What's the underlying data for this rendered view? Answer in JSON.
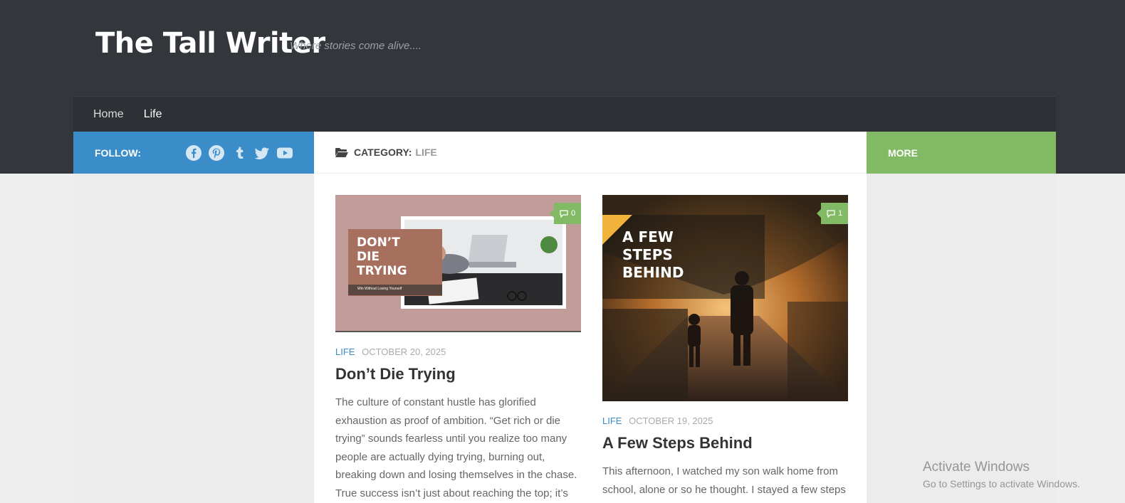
{
  "site": {
    "title": "The Tall Writer",
    "tagline": "Where stories come alive....",
    "nav": [
      {
        "label": "Home"
      },
      {
        "label": "Life"
      }
    ]
  },
  "sidebar_left": {
    "follow_label": "FOLLOW:",
    "social_icons": [
      "facebook-icon",
      "pinterest-icon",
      "tumblr-icon",
      "twitter-icon",
      "youtube-icon"
    ],
    "accent_color": "#3b8dca"
  },
  "sidebar_right": {
    "heading": "MORE",
    "accent_color": "#82b965"
  },
  "category_header": {
    "prefix": "CATEGORY:",
    "name": "LIFE"
  },
  "posts": [
    {
      "category": "LIFE",
      "date": "OCTOBER 20, 2025",
      "title": "Don’t Die Trying",
      "comments": "0",
      "image_text": {
        "headline_lines": [
          "DON’T",
          "DIE",
          "TRYING"
        ],
        "subline": "Win Without Losing Yourself"
      },
      "excerpt": "The culture of constant hustle has glorified exhaustion as proof of ambition. “Get rich or die trying” sounds fearless until you realize too many people are actually dying trying, burning out, breaking down and losing themselves in the chase. True success isn’t just about reaching the top; it’s"
    },
    {
      "category": "LIFE",
      "date": "OCTOBER 19, 2025",
      "title": "A Few Steps Behind",
      "comments": "1",
      "image_text": {
        "headline_lines": [
          "A FEW",
          "STEPS",
          "BEHIND"
        ]
      },
      "excerpt": "This afternoon, I watched my son walk home from school, alone or so he thought. I stayed a few steps"
    }
  ],
  "os_watermark": {
    "line1": "Activate Windows",
    "line2": "Go to Settings to activate Windows."
  }
}
